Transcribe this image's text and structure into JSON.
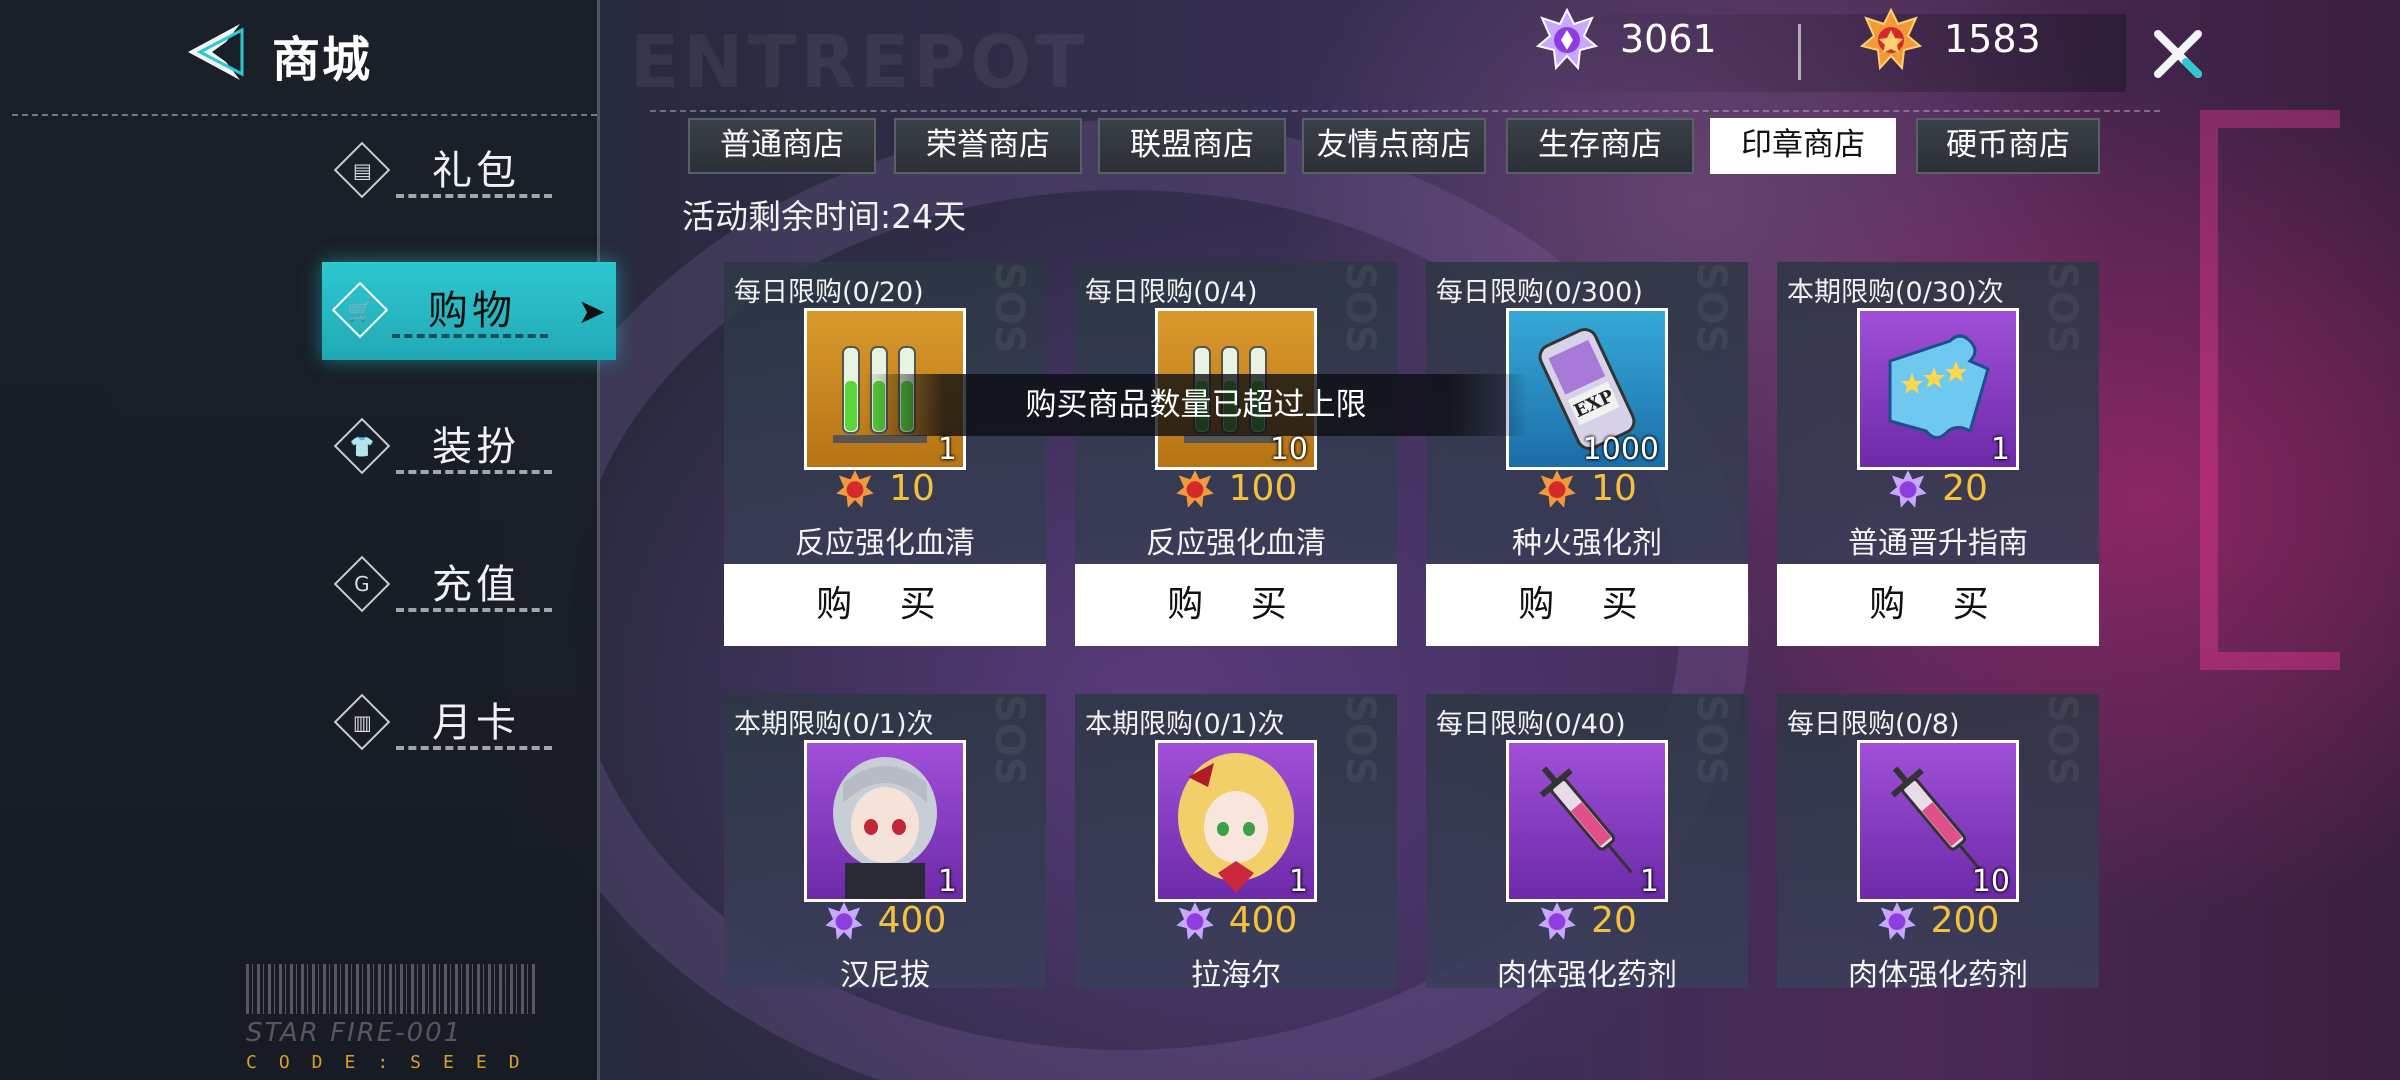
{
  "header": {
    "title": "商城",
    "watermark": "ENTREPOT"
  },
  "sidebar": {
    "items": [
      {
        "label": "礼包",
        "icon": "gift-icon",
        "glyph": "▤"
      },
      {
        "label": "购物",
        "icon": "cart-icon",
        "glyph": "🛒",
        "active": true
      },
      {
        "label": "装扮",
        "icon": "shirt-icon",
        "glyph": "👕"
      },
      {
        "label": "充值",
        "icon": "coin-g-icon",
        "glyph": "G"
      },
      {
        "label": "月卡",
        "icon": "card-icon",
        "glyph": "▥"
      }
    ],
    "footer": {
      "starfire": "STAR FIRE-001",
      "code": "CODE:SEED"
    }
  },
  "currency": {
    "purple_amount": "3061",
    "red_amount": "1583"
  },
  "tabs": [
    "普通商店",
    "荣誉商店",
    "联盟商店",
    "友情点商店",
    "生存商店",
    "印章商店",
    "硬币商店"
  ],
  "active_tab": "印章商店",
  "timer": "活动剩余时间:24天",
  "toast": "购买商品数量已超过上限",
  "buy_label": "购 买",
  "items": [
    {
      "limit": "每日限购(0/20)",
      "qty": "1",
      "price": "10",
      "currency": "red",
      "name": "反应强化血清",
      "frame": "gold",
      "art": "vials"
    },
    {
      "limit": "每日限购(0/4)",
      "qty": "10",
      "price": "100",
      "currency": "red",
      "name": "反应强化血清",
      "frame": "gold",
      "art": "vials"
    },
    {
      "limit": "每日限购(0/300)",
      "qty": "1000",
      "price": "10",
      "currency": "red",
      "name": "种火强化剂",
      "frame": "cyan",
      "art": "exp"
    },
    {
      "limit": "本期限购(0/30)次",
      "qty": "1",
      "price": "20",
      "currency": "purple",
      "name": "普通晋升指南",
      "frame": "purple",
      "art": "puzzle"
    },
    {
      "limit": "本期限购(0/1)次",
      "qty": "1",
      "price": "400",
      "currency": "purple",
      "name": "汉尼拔",
      "frame": "purple",
      "art": "silver-girl"
    },
    {
      "limit": "本期限购(0/1)次",
      "qty": "1",
      "price": "400",
      "currency": "purple",
      "name": "拉海尔",
      "frame": "purple",
      "art": "blonde-girl"
    },
    {
      "limit": "每日限购(0/40)",
      "qty": "1",
      "price": "20",
      "currency": "purple",
      "name": "肉体强化药剂",
      "frame": "purple",
      "art": "syringe"
    },
    {
      "limit": "每日限购(0/8)",
      "qty": "10",
      "price": "200",
      "currency": "purple",
      "name": "肉体强化药剂",
      "frame": "purple",
      "art": "syringe"
    }
  ],
  "colors": {
    "accent": "#2ec8d0",
    "price": "#f3c13a",
    "purple_frame": "#a050d8",
    "gold_frame": "#d99a2c",
    "cyan_frame": "#36a9d8"
  }
}
